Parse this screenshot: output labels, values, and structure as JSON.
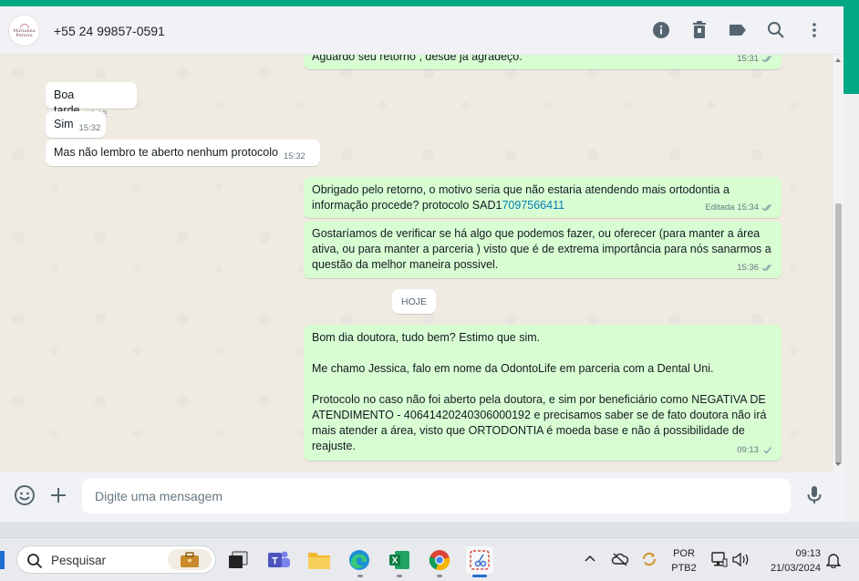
{
  "header": {
    "contact_name": "+55 24 99857-0591",
    "avatar_text": "Marianna Pereira",
    "icons": [
      "info-icon",
      "delete-icon",
      "label-icon",
      "search-icon",
      "more-options-icon"
    ]
  },
  "messages": [
    {
      "dir": "out",
      "text": "Aguardo seu retorno , desde já agradeço.",
      "time": "15:31"
    },
    {
      "dir": "in",
      "text": "Boa tarde",
      "time": "15:32"
    },
    {
      "dir": "in",
      "text": "Sim",
      "time": "15:32"
    },
    {
      "dir": "in",
      "text": "Mas não lembro te aberto nenhum protocolo",
      "time": "15:32"
    },
    {
      "dir": "out",
      "text_line1": "Obrigado pelo retorno, o motivo seria que não estaria atendendo mais ortodontia a",
      "text_line2_prefix": "informação procede? protocolo SAD1",
      "text_link": "7097566411",
      "time": "Editada 15:34"
    },
    {
      "dir": "out",
      "text": "Gostaríamos de verificar se há algo que podemos fazer, ou oferecer (para manter a área ativa, ou para manter a parceria ) visto que é de extrema importância para nós sanarmos a questão da melhor maneira possivel.",
      "time": "15:36"
    },
    {
      "dir": "out",
      "para1": "Bom dia doutora, tudo bem? Estimo que sim.",
      "para2": "Me chamo Jessica, falo em nome da OdontoLife em parceria com a Dental Uni.",
      "para3": "Protocolo no caso não foi aberto pela doutora, e sim por beneficiário como NEGATIVA DE ATENDIMENTO - 40641420240306000192 e precisamos saber se de fato doutora não irá mais atender a área, visto que ORTODONTIA é moeda base e não á possibilidade de reajuste.",
      "time": "09:13"
    }
  ],
  "day_chip": "HOJE",
  "composer": {
    "placeholder": "Digite uma mensagem"
  },
  "taskbar": {
    "search_placeholder": "Pesquisar",
    "apps": [
      "task-view",
      "teams",
      "file-explorer",
      "edge",
      "excel",
      "chrome",
      "snipping-tool"
    ],
    "lang_line1": "POR",
    "lang_line2": "PTB2",
    "time": "09:13",
    "date": "21/03/2024"
  },
  "colors": {
    "accent": "#00a884",
    "outgoing": "#d9fdd3",
    "incoming": "#ffffff",
    "link": "#027eb5"
  }
}
